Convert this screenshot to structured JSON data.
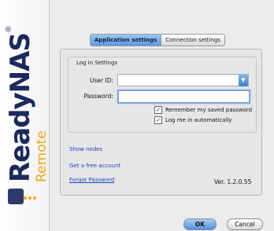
{
  "brand": {
    "name": "ReadyNAS",
    "trademark": "®",
    "subtitle": "Remote"
  },
  "tabs": [
    {
      "label": "Application settings",
      "active": true
    },
    {
      "label": "Connection settings",
      "active": false
    }
  ],
  "login": {
    "group_title": "Log in Settings",
    "userid_label": "User ID:",
    "userid_value": "",
    "password_label": "Password:",
    "password_value": "",
    "remember_label": "Remember my saved password",
    "remember_checked": true,
    "autologin_label": "Log me in automatically",
    "autologin_checked": true
  },
  "links": {
    "show_nodes": "Show nodes",
    "create_account": "Get a free account",
    "forgot_password": "Forgot Password"
  },
  "version": "Ver. 1.2.0.55",
  "buttons": {
    "ok": "OK",
    "cancel": "Cancel"
  },
  "colors": {
    "brand_navy": "#1a2a5c",
    "brand_orange": "#f3a51b",
    "accent_blue": "#4f8fde",
    "link": "#1f3fbf"
  },
  "icons": {
    "dropdown": "chevron-down-icon",
    "check": "checkmark-icon"
  }
}
